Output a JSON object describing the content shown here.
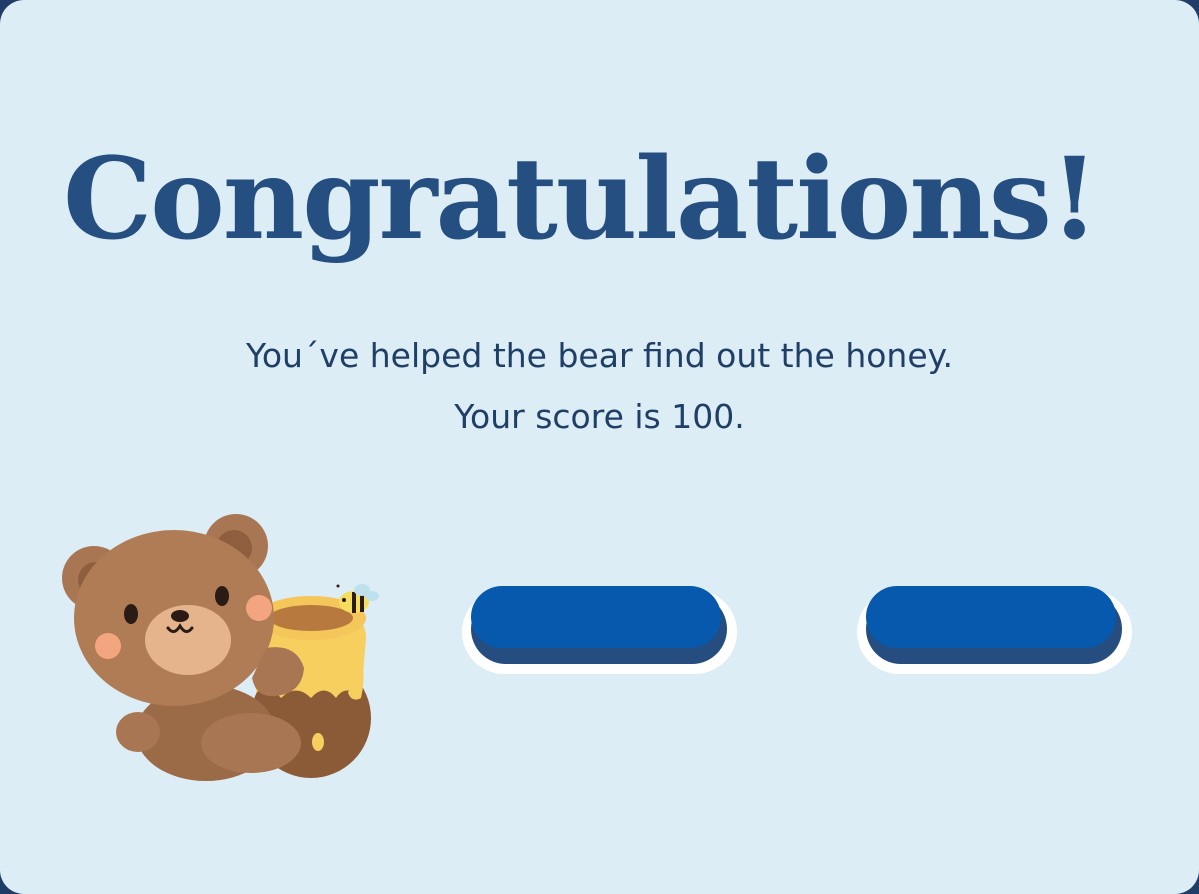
{
  "result": {
    "title": "Congratulations!",
    "message_line1": "You´ve helped the bear find out the honey.",
    "message_line2": "Your score is 100."
  },
  "buttons": {
    "left_label": "",
    "right_label": ""
  },
  "colors": {
    "background": "#dcedf5",
    "title": "#254f80",
    "text": "#1f3f66",
    "button_face": "#0659ad",
    "button_shadow": "#254d80",
    "button_outline": "#ffffff"
  },
  "illustration": {
    "icon": "bear-with-honey-pot-icon",
    "accent_icon": "bee-icon"
  }
}
